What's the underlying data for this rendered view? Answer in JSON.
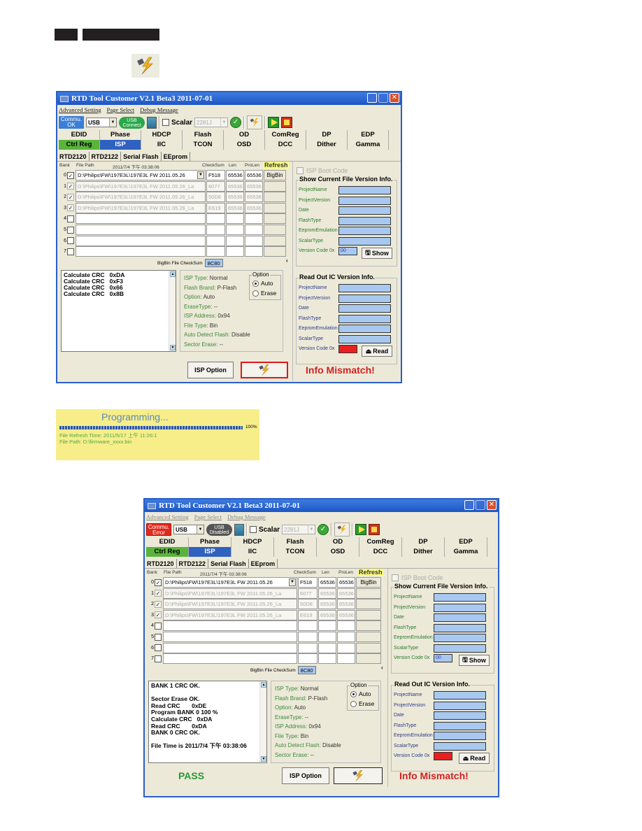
{
  "header_icon": "flash-program-icon",
  "window1": {
    "title": "RTD Tool Customer V2.1 Beta3   2011-07-01",
    "menu": [
      "Advanced Setting",
      "Page Select",
      "Debug Message"
    ],
    "commu_status": "Commu. OK",
    "interface": "USB",
    "usb_status": "USB Connect",
    "scalar_label": "Scalar",
    "scalar_value": "2281J",
    "tabs_row1": [
      "EDID",
      "Phase",
      "HDCP",
      "Flash",
      "OD",
      "ComReg",
      "DP",
      "EDP"
    ],
    "tabs_row2": [
      "Ctrl Reg",
      "ISP",
      "IIC",
      "TCON",
      "OSD",
      "DCC",
      "Dither",
      "Gamma"
    ],
    "subtabs": [
      "RTD2120",
      "RTD2122",
      "Serial Flash",
      "EEprom"
    ],
    "grid": {
      "headers": {
        "bank": "Bank",
        "file_path": "File Path",
        "datetime": "2011/7/4 下午 03:38:06",
        "checksum": "CheckSum",
        "len": "Len",
        "prolen": "ProLen",
        "refresh": "Refresh"
      },
      "rows": [
        {
          "bank": "0",
          "checked": true,
          "enabled": true,
          "path": "D:\\Philips\\FW\\197E3L\\197E3L FW 2011.05.26",
          "checksum": "F518",
          "len": "65536",
          "prolen": "65536",
          "button": "BigBin"
        },
        {
          "bank": "1",
          "checked": true,
          "enabled": false,
          "path": "D:\\Philips\\FW\\197E3L\\197E3L FW 2011.05.26_La",
          "checksum": "6077",
          "len": "65536",
          "prolen": "65536"
        },
        {
          "bank": "2",
          "checked": true,
          "enabled": false,
          "path": "D:\\Philips\\FW\\197E3L\\197E3L FW 2011.05.26_La",
          "checksum": "50D8",
          "len": "65536",
          "prolen": "65536"
        },
        {
          "bank": "3",
          "checked": true,
          "enabled": false,
          "path": "D:\\Philips\\FW\\197E3L\\197E3L FW 2011.05.26_La",
          "checksum": "E619",
          "len": "65536",
          "prolen": "65536"
        },
        {
          "bank": "4",
          "checked": false,
          "enabled": true,
          "path": "",
          "checksum": "",
          "len": "",
          "prolen": ""
        },
        {
          "bank": "5",
          "checked": false,
          "enabled": true,
          "path": "",
          "checksum": "",
          "len": "",
          "prolen": ""
        },
        {
          "bank": "6",
          "checked": false,
          "enabled": true,
          "path": "",
          "checksum": "",
          "len": "",
          "prolen": ""
        },
        {
          "bank": "7",
          "checked": false,
          "enabled": true,
          "path": "",
          "checksum": "",
          "len": "",
          "prolen": ""
        }
      ],
      "bigbin_checksum_label": "BigBin File CheckSum",
      "bigbin_checksum_value": "8C80"
    },
    "log": "Calculate CRC   0xDA\nCalculate CRC   0xF3\nCalculate CRC   0x66\nCalculate CRC   0x8B",
    "isp_info": [
      {
        "label": "ISP Type:",
        "value": "Normal"
      },
      {
        "label": "Flash Brand:",
        "value": "P-Flash"
      },
      {
        "label": "Option:",
        "value": "Auto"
      },
      {
        "label": "EraseType:",
        "value": "--"
      },
      {
        "label": "ISP Address:",
        "value": "0x94"
      },
      {
        "label": "File Type:",
        "value": "Bin"
      },
      {
        "label": "Auto Detect Flash:",
        "value": "Disable"
      },
      {
        "label": "Sector Erase:",
        "value": "--"
      }
    ],
    "option_group": {
      "title": "Option",
      "auto": "Auto",
      "erase": "Erase",
      "selected": "Auto"
    },
    "isp_option_button": "ISP Option",
    "isp_boot_code": "ISP Boot Code",
    "file_version": {
      "title": "Show Current File Version Info.",
      "fields": [
        "ProjectName",
        "ProjectVersion",
        "Date",
        "FlashType",
        "EepromEmulation",
        "ScalarType"
      ],
      "version_code_label": "Version Code  0x",
      "version_code_value": "00",
      "button": "Show"
    },
    "ic_version": {
      "title": "Read Out IC Version Info.",
      "fields": [
        "ProjectName",
        "ProjectVersion",
        "Date",
        "FlashType",
        "EepromEmulation",
        "ScalarType"
      ],
      "version_code_label": "Version Code  0x",
      "version_code_value": "",
      "button": "Read"
    },
    "status": "Info Mismatch!"
  },
  "programming": {
    "title": "Programming...",
    "progress_percent": 100,
    "progress_label": "100%",
    "refresh_time": "File Refresh Time: 2011/5/17 上午 11:26:1",
    "file_path": "File Path: D:\\firmware_xxxx.bin"
  },
  "window2": {
    "title": "RTD Tool Customer V2.1 Beta3   2011-07-01",
    "menu": [
      "Advanced Setting",
      "Page Select",
      "Debug Message"
    ],
    "commu_status": "Commu. Error",
    "interface": "USB",
    "usb_status": "USB Disabled",
    "scalar_label": "Scalar",
    "scalar_value": "2281J",
    "tabs_row1": [
      "EDID",
      "Phase",
      "HDCP",
      "Flash",
      "OD",
      "ComReg",
      "DP",
      "EDP"
    ],
    "tabs_row2": [
      "Ctrl Reg",
      "ISP",
      "IIC",
      "TCON",
      "OSD",
      "DCC",
      "Dither",
      "Gamma"
    ],
    "subtabs": [
      "RTD2120",
      "RTD2122",
      "Serial Flash",
      "EEprom"
    ],
    "grid": {
      "headers": {
        "bank": "Bank",
        "file_path": "File Path",
        "datetime": "2011/7/4 下午 03:38:06",
        "checksum": "CheckSum",
        "len": "Len",
        "prolen": "ProLen",
        "refresh": "Refresh"
      },
      "rows": [
        {
          "bank": "0",
          "checked": true,
          "enabled": true,
          "path": "D:\\Philips\\FW\\197E3L\\197E3L FW 2011.05.26",
          "checksum": "F518",
          "len": "65536",
          "prolen": "65536",
          "button": "BigBin"
        },
        {
          "bank": "1",
          "checked": true,
          "enabled": false,
          "path": "D:\\Philips\\FW\\197E3L\\197E3L FW 2011.05.26_La",
          "checksum": "6077",
          "len": "65536",
          "prolen": "65536"
        },
        {
          "bank": "2",
          "checked": true,
          "enabled": false,
          "path": "D:\\Philips\\FW\\197E3L\\197E3L FW 2011.05.26_La",
          "checksum": "50D8",
          "len": "65536",
          "prolen": "65536"
        },
        {
          "bank": "3",
          "checked": true,
          "enabled": false,
          "path": "D:\\Philips\\FW\\197E3L\\197E3L FW 2011.05.26_La",
          "checksum": "E619",
          "len": "65536",
          "prolen": "65536"
        },
        {
          "bank": "4",
          "checked": false,
          "enabled": true,
          "path": "",
          "checksum": "",
          "len": "",
          "prolen": ""
        },
        {
          "bank": "5",
          "checked": false,
          "enabled": true,
          "path": "",
          "checksum": "",
          "len": "",
          "prolen": ""
        },
        {
          "bank": "6",
          "checked": false,
          "enabled": true,
          "path": "",
          "checksum": "",
          "len": "",
          "prolen": ""
        },
        {
          "bank": "7",
          "checked": false,
          "enabled": true,
          "path": "",
          "checksum": "",
          "len": "",
          "prolen": ""
        }
      ],
      "bigbin_checksum_label": "BigBin File CheckSum",
      "bigbin_checksum_value": "8C80"
    },
    "log": "BANK 1 CRC OK.\n\nSector Erase OK.\nRead CRC       0xDE\nProgram BANK 0 100 %\nCalculate CRC   0xDA\nRead CRC       0xDA\nBANK 0 CRC OK.\n\nFile Time is 2011/7/4 下午 03:38:06",
    "isp_info": [
      {
        "label": "ISP Type:",
        "value": "Normal"
      },
      {
        "label": "Flash Brand:",
        "value": "P-Flash"
      },
      {
        "label": "Option:",
        "value": "Auto"
      },
      {
        "label": "EraseType:",
        "value": "--"
      },
      {
        "label": "ISP Address:",
        "value": "0x94"
      },
      {
        "label": "File Type:",
        "value": "Bin"
      },
      {
        "label": "Auto Detect Flash:",
        "value": "Disable"
      },
      {
        "label": "Sector Erase:",
        "value": "--"
      }
    ],
    "option_group": {
      "title": "Option",
      "auto": "Auto",
      "erase": "Erase",
      "selected": "Auto"
    },
    "isp_option_button": "ISP Option",
    "pass_label": "PASS",
    "isp_boot_code": "ISP Boot Code",
    "file_version": {
      "title": "Show Current File Version Info.",
      "fields": [
        "ProjectName",
        "ProjectVersion",
        "Date",
        "FlashType",
        "EepromEmulation",
        "ScalarType"
      ],
      "version_code_label": "Version Code  0x",
      "version_code_value": "00",
      "button": "Show"
    },
    "ic_version": {
      "title": "Read Out IC Version Info.",
      "fields": [
        "ProjectName",
        "ProjectVersion",
        "Date",
        "FlashType",
        "EepromEmulation",
        "ScalarType"
      ],
      "version_code_label": "Version Code  0x",
      "version_code_value": "",
      "button": "Read"
    },
    "status": "Info Mismatch!"
  }
}
